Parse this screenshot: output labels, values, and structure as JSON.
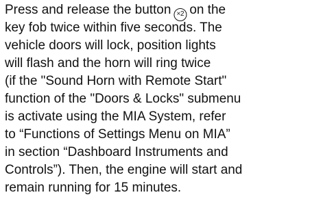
{
  "document": {
    "lines": [
      {
        "before_icon": "Press and release the button",
        "icon_text": "×2",
        "after_icon": "on the"
      },
      "key fob twice within five seconds. The",
      "vehicle doors will lock, position lights",
      "will flash and the horn will ring twice",
      "(if the \"Sound Horn with Remote Start\"",
      "function of the \"Doors & Locks\" submenu",
      "is activate using the MIA System, refer",
      "to “Functions of Settings Menu on MIA”",
      "in section “Dashboard Instruments and",
      "Controls”). Then, the engine will start and",
      "remain running for 15 minutes."
    ]
  }
}
